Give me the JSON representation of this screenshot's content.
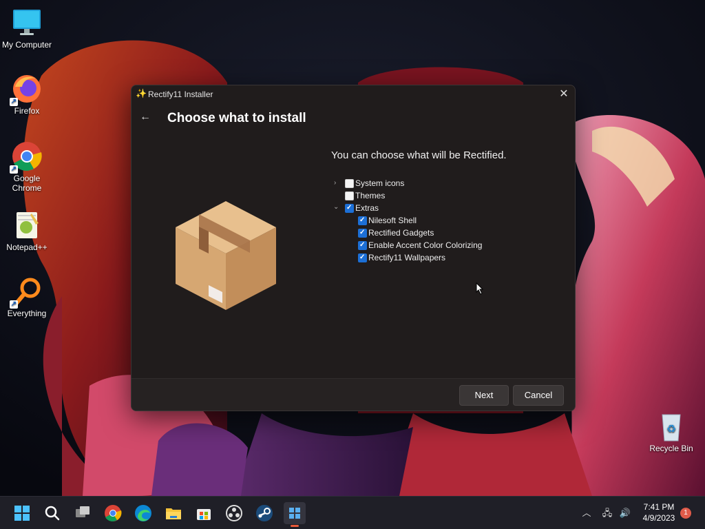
{
  "desktop": {
    "icons": [
      {
        "label": "My Computer"
      },
      {
        "label": "Firefox"
      },
      {
        "label": "Google Chrome"
      },
      {
        "label": "Notepad++"
      },
      {
        "label": "Everything"
      },
      {
        "label": "Recycle Bin"
      }
    ]
  },
  "dialog": {
    "title": "Rectify11 Installer",
    "heading": "Choose what to install",
    "subtitle": "You can choose what will be Rectified.",
    "tree": [
      {
        "label": "System icons",
        "checked": false,
        "expanded": false,
        "level": 0
      },
      {
        "label": "Themes",
        "checked": false,
        "level": 0
      },
      {
        "label": "Extras",
        "checked": true,
        "expanded": true,
        "level": 0
      },
      {
        "label": "Nilesoft Shell",
        "checked": true,
        "level": 1
      },
      {
        "label": "Rectified Gadgets",
        "checked": true,
        "level": 1
      },
      {
        "label": "Enable Accent Color Colorizing",
        "checked": true,
        "level": 1
      },
      {
        "label": "Rectify11 Wallpapers",
        "checked": true,
        "level": 1
      }
    ],
    "buttons": {
      "next": "Next",
      "cancel": "Cancel"
    }
  },
  "taskbar": {
    "apps": [
      "start",
      "search",
      "task-view",
      "chrome",
      "edge",
      "file-explorer",
      "store",
      "obs",
      "steam",
      "rectify11-installer"
    ],
    "time": "7:41 PM",
    "date": "4/9/2023",
    "notification_count": "1"
  }
}
